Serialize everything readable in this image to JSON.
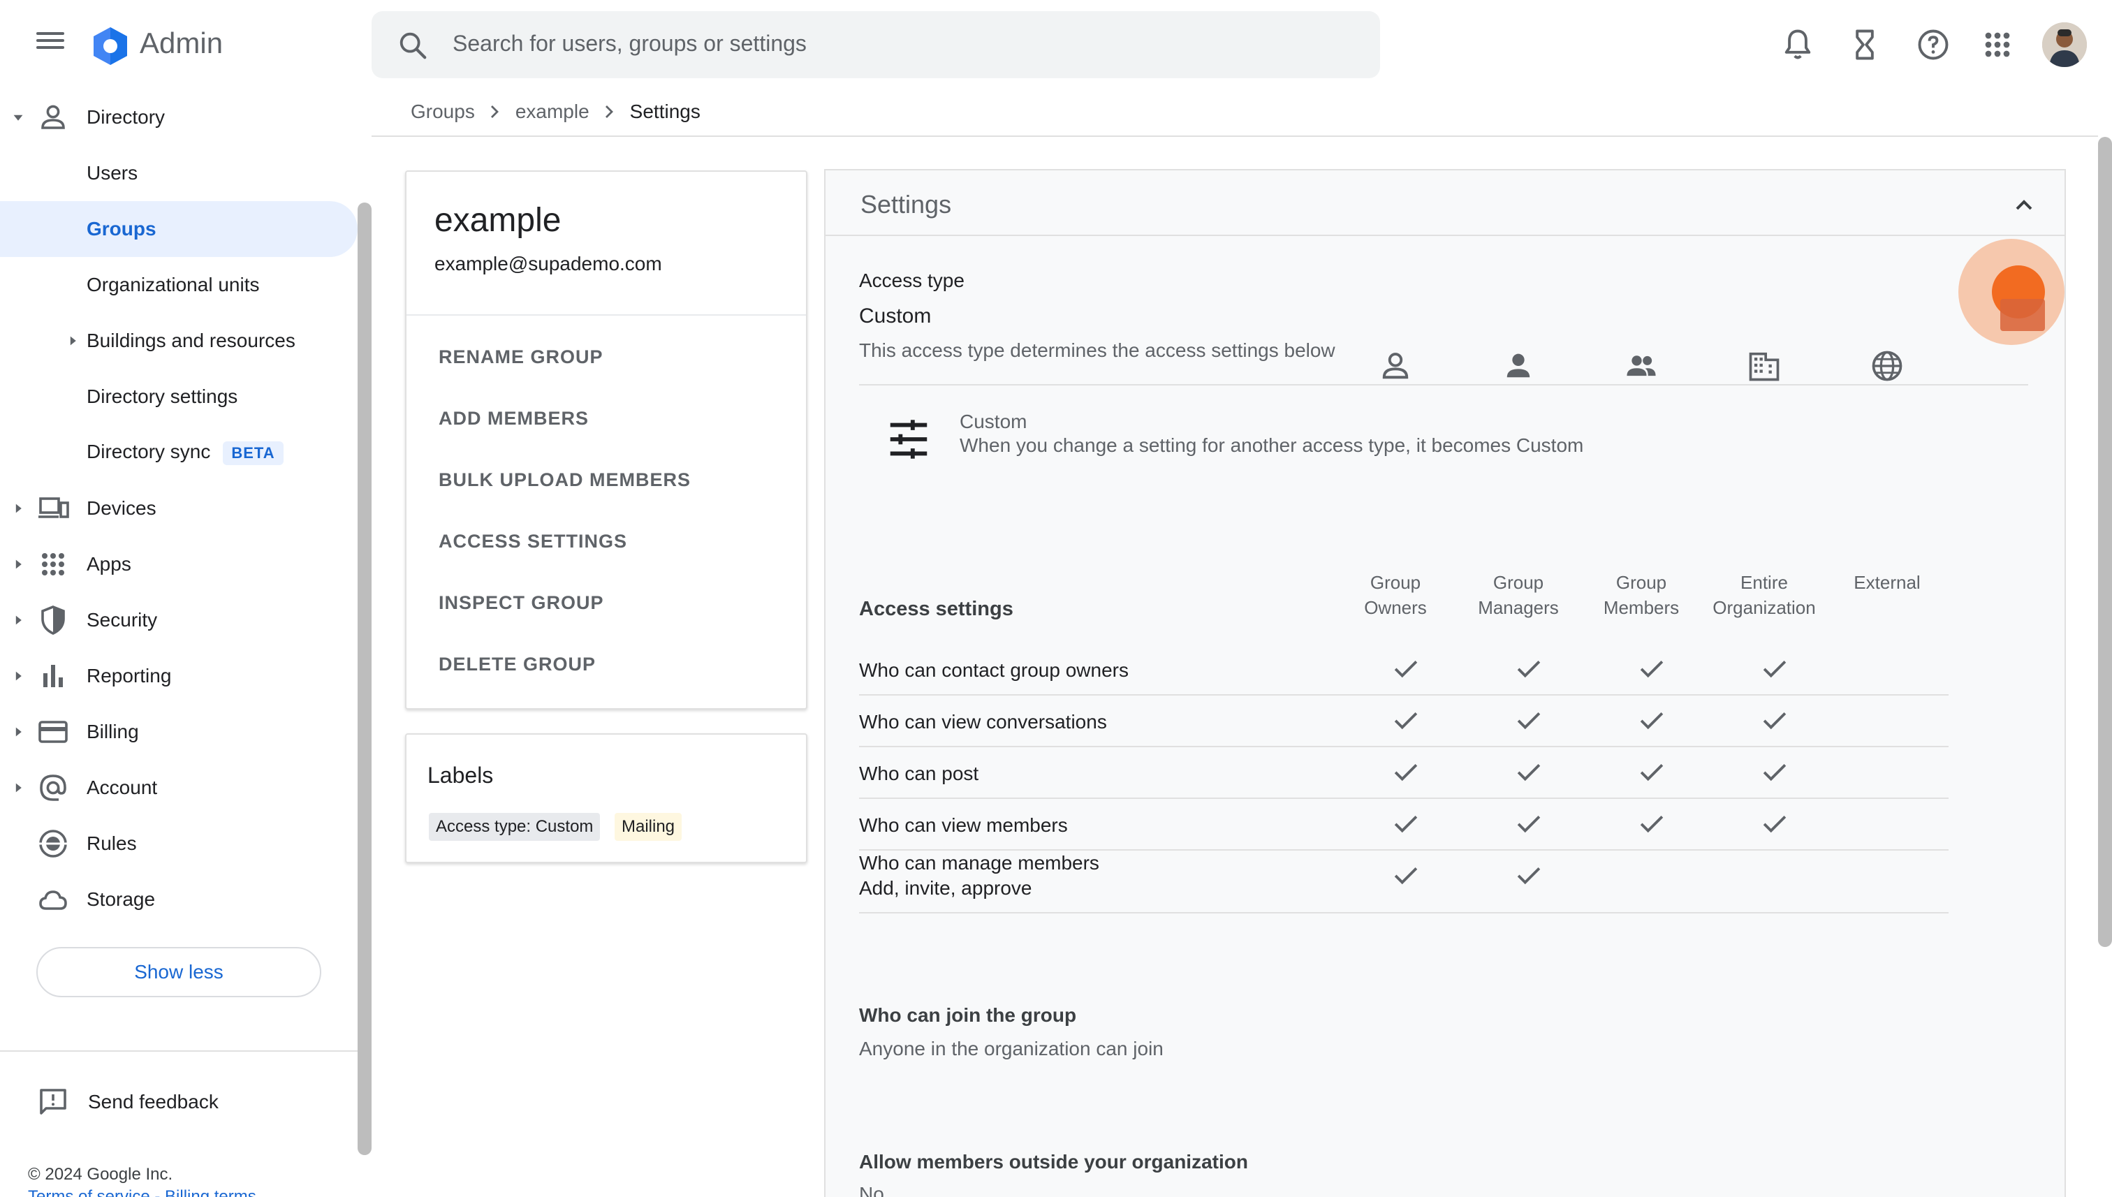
{
  "header": {
    "brand": "Admin",
    "search_placeholder": "Search for users, groups or settings"
  },
  "sidebar": {
    "items": [
      {
        "label": "Directory"
      },
      {
        "label": "Users"
      },
      {
        "label": "Groups"
      },
      {
        "label": "Organizational units"
      },
      {
        "label": "Buildings and resources"
      },
      {
        "label": "Directory settings"
      },
      {
        "label": "Directory sync",
        "badge": "BETA"
      },
      {
        "label": "Devices"
      },
      {
        "label": "Apps"
      },
      {
        "label": "Security"
      },
      {
        "label": "Reporting"
      },
      {
        "label": "Billing"
      },
      {
        "label": "Account"
      },
      {
        "label": "Rules"
      },
      {
        "label": "Storage"
      }
    ],
    "show_less": "Show less",
    "send_feedback": "Send feedback",
    "copyright": "© 2024 Google Inc.",
    "terms": "Terms of service",
    "billing_terms": "Billing terms"
  },
  "breadcrumb": {
    "items": [
      "Groups",
      "example",
      "Settings"
    ]
  },
  "group": {
    "name": "example",
    "email": "example@supademo.com",
    "actions": [
      "RENAME GROUP",
      "ADD MEMBERS",
      "BULK UPLOAD MEMBERS",
      "ACCESS SETTINGS",
      "INSPECT GROUP",
      "DELETE GROUP"
    ]
  },
  "labels": {
    "title": "Labels",
    "chips": [
      "Access type: Custom",
      "Mailing"
    ]
  },
  "settings": {
    "title": "Settings",
    "access_type_label": "Access type",
    "access_type_value": "Custom",
    "access_type_desc": "This access type determines the access settings below",
    "custom_title": "Custom",
    "custom_desc": "When you change a setting for another access type, it becomes Custom",
    "access_settings_header": "Access settings",
    "columns": [
      {
        "line1": "Group",
        "line2": "Owners"
      },
      {
        "line1": "Group",
        "line2": "Managers"
      },
      {
        "line1": "Group",
        "line2": "Members"
      },
      {
        "line1": "Entire",
        "line2": "Organization"
      },
      {
        "line1": "External",
        "line2": ""
      }
    ],
    "rows": [
      {
        "label": "Who can contact group owners",
        "sub": "",
        "checks": [
          true,
          true,
          true,
          true,
          false
        ]
      },
      {
        "label": "Who can view conversations",
        "sub": "",
        "checks": [
          true,
          true,
          true,
          true,
          false
        ]
      },
      {
        "label": "Who can post",
        "sub": "",
        "checks": [
          true,
          true,
          true,
          true,
          false
        ]
      },
      {
        "label": "Who can view members",
        "sub": "",
        "checks": [
          true,
          true,
          true,
          true,
          false
        ]
      },
      {
        "label": "Who can manage members",
        "sub": "Add, invite, approve",
        "checks": [
          true,
          true,
          false,
          false,
          false
        ]
      }
    ],
    "join_title": "Who can join the group",
    "join_value": "Anyone in the organization can join",
    "outside_title": "Allow members outside your organization",
    "outside_value": "No"
  },
  "colors": {
    "accent": "#1967d2",
    "active_bg": "#e8f0fe",
    "chip_primary": "#e8eaed",
    "chip_mailing": "#fef7e0",
    "highlight": "#f26b21"
  }
}
